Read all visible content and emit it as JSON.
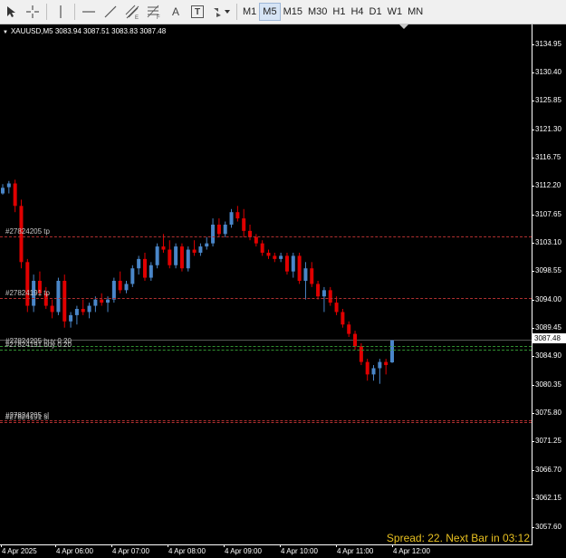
{
  "toolbar": {
    "tools": [
      {
        "name": "cursor-icon"
      },
      {
        "name": "crosshair-icon"
      },
      {
        "name": "vertical-line-icon"
      },
      {
        "name": "horizontal-line-icon"
      },
      {
        "name": "trendline-icon"
      },
      {
        "name": "equidistant-channel-icon"
      },
      {
        "name": "fibonacci-retracement-icon"
      },
      {
        "name": "text-icon",
        "glyph": "A"
      },
      {
        "name": "text-label-icon",
        "glyph": "T"
      },
      {
        "name": "shapes-icon"
      }
    ],
    "timeframes": [
      "M1",
      "M5",
      "M15",
      "M30",
      "H1",
      "H4",
      "D1",
      "W1",
      "MN"
    ],
    "active_timeframe": "M5"
  },
  "chart": {
    "header": "XAUUSD,M5  3083.94 3087.51 3083.83 3087.48",
    "current_price": "3087.48",
    "price_labels": [
      "3134.95",
      "3130.40",
      "3125.85",
      "3121.30",
      "3116.75",
      "3112.20",
      "3107.65",
      "3103.10",
      "3098.55",
      "3094.00",
      "3089.45",
      "3084.90",
      "3080.35",
      "3075.80",
      "3071.25",
      "3066.70",
      "3062.15",
      "3057.60"
    ],
    "time_labels": [
      "4 Apr 2025",
      "4 Apr 06:00",
      "4 Apr 07:00",
      "4 Apr 08:00",
      "4 Apr 09:00",
      "4 Apr 10:00",
      "4 Apr 11:00",
      "4 Apr 12:00"
    ],
    "orders": [
      {
        "label": "#27824205 tp",
        "price": 3104.1,
        "color": "#b03030"
      },
      {
        "label": "#27824191 tp",
        "price": 3094.3,
        "color": "#b03030"
      },
      {
        "label": "#27824205 buy 0.20",
        "price": 3086.5,
        "color": "#309030"
      },
      {
        "label": "#27824191 buy 0.20",
        "price": 3085.9,
        "color": "#309030"
      },
      {
        "label": "#27824205 sl",
        "price": 3074.6,
        "color": "#b03030"
      },
      {
        "label": "#27824191 sl",
        "price": 3074.4,
        "color": "#b03030"
      }
    ],
    "spread_text": "Spread: 22. Next Bar in 03:12",
    "colors": {
      "bull": "#4a86c8",
      "bear": "#e00000",
      "background": "#000000"
    }
  },
  "chart_data": {
    "type": "candlestick",
    "symbol": "XAUUSD",
    "timeframe": "M5",
    "last_ohlc": {
      "open": 3083.94,
      "high": 3087.51,
      "low": 3083.83,
      "close": 3087.48
    },
    "ylim": [
      3057.6,
      3137.0
    ],
    "candles": [
      [
        3111.0,
        3112.5,
        3110.8,
        3111.9
      ],
      [
        3112.0,
        3113.0,
        3111.0,
        3112.6
      ],
      [
        3112.6,
        3113.2,
        3108.0,
        3109.0
      ],
      [
        3109.0,
        3110.0,
        3099.0,
        3100.0
      ],
      [
        3100.0,
        3100.5,
        3092.0,
        3093.0
      ],
      [
        3093.0,
        3098.0,
        3092.0,
        3097.0
      ],
      [
        3097.0,
        3098.5,
        3094.5,
        3095.0
      ],
      [
        3095.0,
        3096.0,
        3092.5,
        3093.0
      ],
      [
        3093.0,
        3094.0,
        3091.0,
        3092.0
      ],
      [
        3092.0,
        3097.5,
        3091.5,
        3097.0
      ],
      [
        3097.0,
        3098.0,
        3089.5,
        3090.5
      ],
      [
        3090.5,
        3092.0,
        3089.5,
        3091.5
      ],
      [
        3091.5,
        3093.0,
        3090.0,
        3092.5
      ],
      [
        3092.5,
        3094.0,
        3091.5,
        3092.0
      ],
      [
        3092.0,
        3093.5,
        3091.0,
        3093.0
      ],
      [
        3093.0,
        3094.5,
        3092.0,
        3094.0
      ],
      [
        3094.0,
        3095.0,
        3093.0,
        3093.5
      ],
      [
        3093.5,
        3094.5,
        3092.0,
        3094.0
      ],
      [
        3094.0,
        3097.5,
        3093.5,
        3097.0
      ],
      [
        3097.0,
        3098.5,
        3095.0,
        3095.5
      ],
      [
        3095.5,
        3097.0,
        3095.0,
        3096.5
      ],
      [
        3096.5,
        3099.5,
        3096.0,
        3099.0
      ],
      [
        3099.0,
        3101.0,
        3098.0,
        3100.5
      ],
      [
        3100.5,
        3101.5,
        3097.0,
        3097.5
      ],
      [
        3097.5,
        3100.0,
        3097.0,
        3099.5
      ],
      [
        3099.5,
        3103.0,
        3099.0,
        3102.5
      ],
      [
        3102.5,
        3104.5,
        3101.5,
        3102.0
      ],
      [
        3102.0,
        3103.5,
        3099.0,
        3099.5
      ],
      [
        3099.5,
        3103.0,
        3099.0,
        3102.5
      ],
      [
        3102.5,
        3103.0,
        3098.5,
        3099.0
      ],
      [
        3099.0,
        3102.5,
        3098.5,
        3102.0
      ],
      [
        3102.0,
        3103.5,
        3101.0,
        3101.5
      ],
      [
        3101.5,
        3103.0,
        3101.0,
        3102.5
      ],
      [
        3102.5,
        3104.0,
        3102.0,
        3103.0
      ],
      [
        3103.0,
        3107.0,
        3102.5,
        3106.0
      ],
      [
        3106.0,
        3107.0,
        3104.0,
        3104.5
      ],
      [
        3104.5,
        3106.5,
        3104.0,
        3106.0
      ],
      [
        3106.0,
        3108.5,
        3105.5,
        3108.0
      ],
      [
        3108.0,
        3109.0,
        3106.5,
        3107.0
      ],
      [
        3107.0,
        3108.5,
        3104.0,
        3105.0
      ],
      [
        3105.0,
        3106.0,
        3103.5,
        3104.0
      ],
      [
        3104.0,
        3104.5,
        3102.5,
        3103.0
      ],
      [
        3103.0,
        3103.5,
        3101.0,
        3101.5
      ],
      [
        3101.5,
        3102.0,
        3100.5,
        3101.0
      ],
      [
        3101.0,
        3101.5,
        3100.0,
        3100.5
      ],
      [
        3100.5,
        3101.5,
        3100.0,
        3101.0
      ],
      [
        3101.0,
        3101.5,
        3098.0,
        3098.5
      ],
      [
        3098.5,
        3101.5,
        3097.5,
        3101.0
      ],
      [
        3101.0,
        3101.5,
        3096.5,
        3097.0
      ],
      [
        3097.0,
        3100.0,
        3094.0,
        3099.0
      ],
      [
        3099.0,
        3100.0,
        3096.0,
        3096.5
      ],
      [
        3096.5,
        3097.0,
        3094.0,
        3094.5
      ],
      [
        3094.5,
        3096.0,
        3092.0,
        3095.5
      ],
      [
        3095.5,
        3096.0,
        3093.0,
        3093.5
      ],
      [
        3093.5,
        3094.5,
        3091.5,
        3092.0
      ],
      [
        3092.0,
        3092.5,
        3089.5,
        3090.0
      ],
      [
        3090.0,
        3090.5,
        3088.0,
        3088.5
      ],
      [
        3088.5,
        3089.0,
        3086.0,
        3086.5
      ],
      [
        3086.5,
        3087.0,
        3083.5,
        3084.0
      ],
      [
        3084.0,
        3084.5,
        3081.0,
        3082.0
      ],
      [
        3082.0,
        3083.5,
        3081.0,
        3083.0
      ],
      [
        3083.0,
        3084.5,
        3080.5,
        3084.0
      ],
      [
        3084.0,
        3084.5,
        3082.0,
        3083.5
      ],
      [
        3083.94,
        3087.51,
        3083.83,
        3087.48
      ]
    ]
  }
}
